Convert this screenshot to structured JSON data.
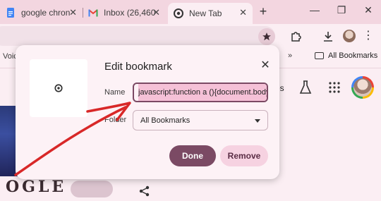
{
  "tabs": [
    {
      "title": "google chron",
      "favicon": "google-docs-icon"
    },
    {
      "title": "Inbox (26,460",
      "favicon": "gmail-icon"
    },
    {
      "title": "New Tab",
      "favicon": "chrome-icon",
      "active": true
    }
  ],
  "toolbar": {
    "icons": [
      "bookmark-star-icon",
      "extensions-puzzle-icon",
      "download-icon",
      "profile-avatar-icon",
      "kebab-menu-icon"
    ]
  },
  "bookmarks_bar": {
    "left_partial": "Voic",
    "all_bookmarks": "All Bookmarks"
  },
  "page": {
    "partial_text": "es",
    "logo_text": "OGLE"
  },
  "dialog": {
    "title": "Edit bookmark",
    "name_label": "Name",
    "name_value": "javascript:function a (){document.body.i",
    "folder_label": "Folder",
    "folder_value": "All Bookmarks",
    "done_label": "Done",
    "remove_label": "Remove"
  },
  "colors": {
    "accent": "#7b4a64",
    "tabstrip": "#f3d6e0",
    "surface": "#fbeef3",
    "annotation": "#d82828"
  }
}
